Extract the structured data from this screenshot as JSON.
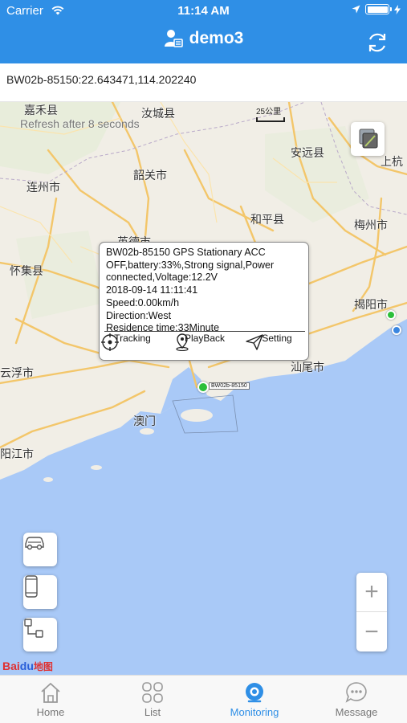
{
  "status_bar": {
    "carrier": "Carrier",
    "time": "11:14 AM"
  },
  "nav": {
    "title": "demo3",
    "refresh_icon": "refresh-icon",
    "user_icon": "user-card-icon"
  },
  "coord_line": "BW02b-85150:22.643471,114.202240",
  "map": {
    "refresh_note": "Refresh after 8 seconds",
    "scale_label": "25公里",
    "cities": [
      {
        "name": "嘉禾县"
      },
      {
        "name": "汝城县"
      },
      {
        "name": "安远县"
      },
      {
        "name": "上杭"
      },
      {
        "name": "连州市"
      },
      {
        "name": "韶关市"
      },
      {
        "name": "和平县"
      },
      {
        "name": "梅州市"
      },
      {
        "name": "怀集县"
      },
      {
        "name": "英德市"
      },
      {
        "name": "揭阳市"
      },
      {
        "name": "云浮市"
      },
      {
        "name": "汕尾市"
      },
      {
        "name": "澳门"
      },
      {
        "name": "阳江市"
      }
    ],
    "popup": {
      "lines": [
        "BW02b-85150  GPS Stationary ACC",
        "OFF,battery:33%,Strong signal,Power",
        "connected,Voltage:12.2V",
        "2018-09-14 11:11:41",
        "Speed:0.00km/h",
        "Direction:West",
        "Residence time:33Minute"
      ],
      "actions": [
        {
          "label": "Tracking",
          "icon": "target-icon"
        },
        {
          "label": "PlayBack",
          "icon": "location-pin-icon"
        },
        {
          "label": "Setting",
          "icon": "send-icon"
        }
      ]
    },
    "marker_label": "BW02b-85150",
    "logo": {
      "part1": "Bai",
      "part2": "du",
      "part3": "地图"
    },
    "colors": {
      "land": "#f1eee6",
      "sea": "#a9c9f7",
      "road": "#f3c66a",
      "marker": "#2bbf3a"
    }
  },
  "side_buttons": [
    {
      "icon": "car-icon"
    },
    {
      "icon": "phone-icon"
    },
    {
      "icon": "route-icon"
    }
  ],
  "zoom": {
    "in": "+",
    "out": "−"
  },
  "tabs": [
    {
      "label": "Home",
      "icon": "home-icon"
    },
    {
      "label": "List",
      "icon": "grid-icon"
    },
    {
      "label": "Monitoring",
      "icon": "monitoring-icon",
      "active": true
    },
    {
      "label": "Message",
      "icon": "chat-icon"
    }
  ],
  "colors": {
    "accent": "#2f8fe6"
  }
}
